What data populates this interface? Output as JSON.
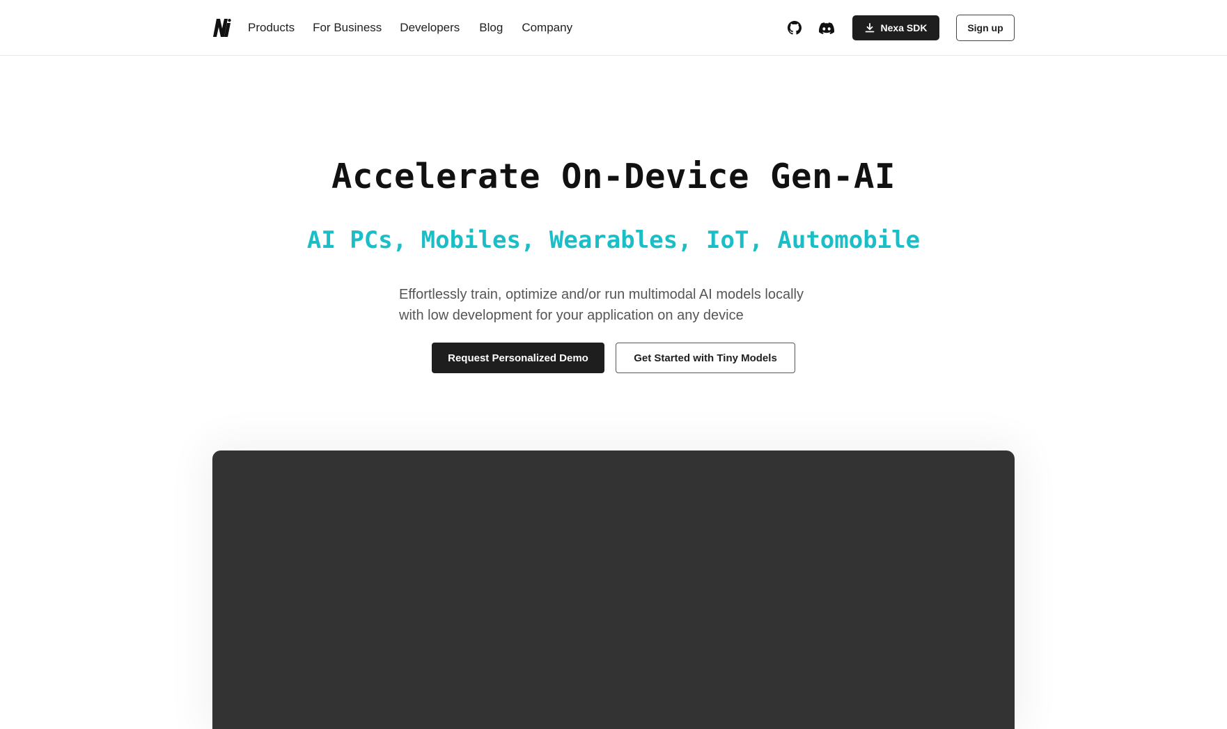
{
  "header": {
    "logo_alt": "N",
    "nav": [
      {
        "label": "Products"
      },
      {
        "label": "For Business"
      },
      {
        "label": "Developers"
      },
      {
        "label": "Blog"
      },
      {
        "label": "Company"
      }
    ],
    "icons": {
      "github": "github-icon",
      "discord": "discord-icon"
    },
    "sdk_button": "Nexa SDK",
    "signup_button": "Sign up"
  },
  "hero": {
    "title": "Accelerate On-Device Gen-AI",
    "subtitle": "AI PCs, Mobiles, Wearables, IoT, Automobile",
    "description_line1": "Effortlessly train, optimize and/or run multimodal AI models locally",
    "description_line2": "with low development for your application on any device",
    "primary_cta": "Request Personalized Demo",
    "secondary_cta": "Get Started with Tiny Models"
  },
  "colors": {
    "accent": "#1bbec6",
    "dark": "#1e1e1e",
    "panel": "#333333"
  }
}
